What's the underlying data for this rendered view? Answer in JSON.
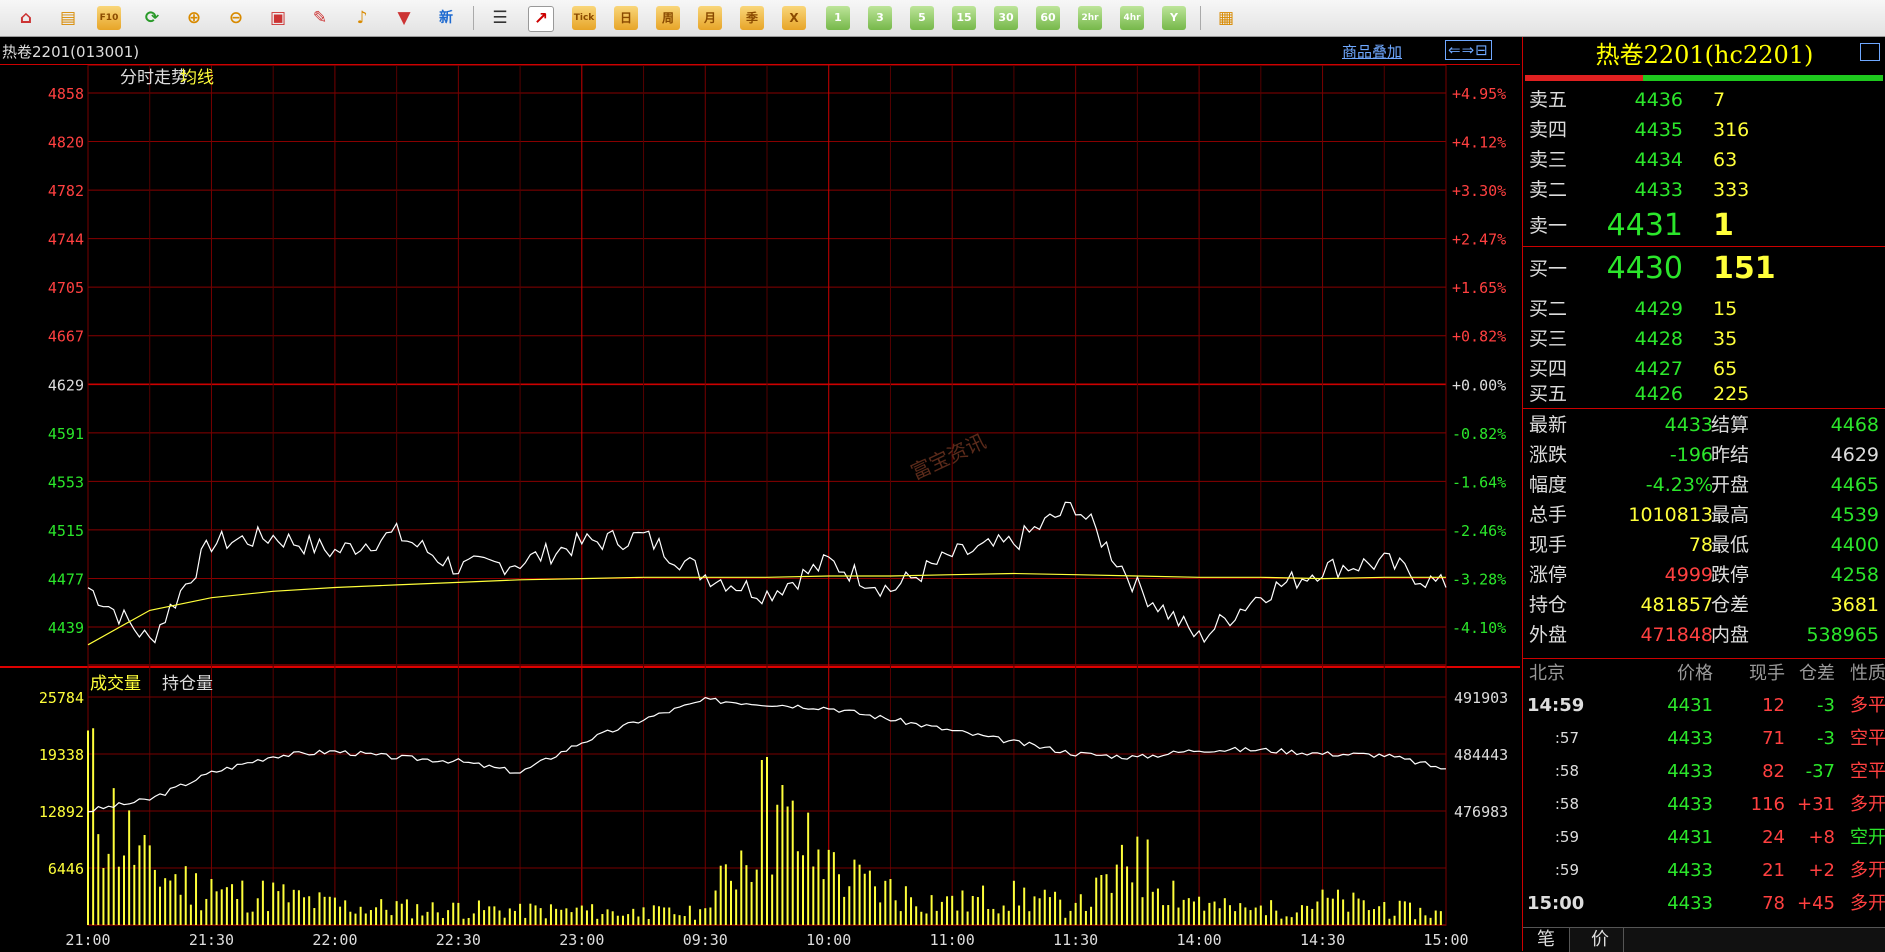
{
  "toolbar": {
    "items": [
      "home",
      "book",
      "f10",
      "refresh",
      "zoom-in",
      "zoom-out",
      "window",
      "pencil",
      "bell",
      "filter",
      "news"
    ],
    "news_label": "新",
    "f10_label": "F10",
    "tick_label": "Tick",
    "periods": [
      "日",
      "周",
      "月",
      "季",
      "X"
    ],
    "minutes": [
      "1",
      "3",
      "5",
      "15",
      "30",
      "60",
      "2hr",
      "4hr",
      "Y"
    ]
  },
  "header": {
    "symbol": "热卷2201(013001)",
    "overlay_link": "商品叠加"
  },
  "chart": {
    "price_title": "分时走势",
    "avg_title": "均线",
    "vol_title": "成交量",
    "oi_title": "持仓量",
    "price_ticks": [
      "4858",
      "4820",
      "4782",
      "4744",
      "4705",
      "4667",
      "4629",
      "4591",
      "4553",
      "4515",
      "4477",
      "4439"
    ],
    "pct_ticks": [
      "+4.95%",
      "+4.12%",
      "+3.30%",
      "+2.47%",
      "+1.65%",
      "+0.82%",
      "+0.00%",
      "-0.82%",
      "-1.64%",
      "-2.46%",
      "-3.28%",
      "-4.10%"
    ],
    "vol_ticks": [
      "25784",
      "19338",
      "12892",
      "6446"
    ],
    "oi_ticks": [
      "491903",
      "484443",
      "476983"
    ],
    "time_ticks": [
      "21:00",
      "21:30",
      "22:00",
      "22:30",
      "23:00",
      "09:30",
      "10:00",
      "11:00",
      "11:30",
      "14:00",
      "14:30",
      "15:00"
    ],
    "watermark": "富宝资讯"
  },
  "chart_data": {
    "type": "line",
    "price_range": [
      4439,
      4858
    ],
    "prev_settle": 4629,
    "avg_price": [
      4425,
      4452,
      4462,
      4467,
      4470,
      4472,
      4474,
      4476,
      4477,
      4478,
      4478,
      4478,
      4479,
      4479,
      4480,
      4481,
      4480,
      4479,
      4478,
      4478,
      4477,
      4478,
      4478
    ],
    "price": [
      4470,
      4428,
      4505,
      4510,
      4498,
      4512,
      4485,
      4490,
      4505,
      4510,
      4480,
      4465,
      4490,
      4468,
      4495,
      4505,
      4535,
      4470,
      4430,
      4465,
      4485,
      4490,
      4470
    ],
    "volume": [
      22000,
      9000,
      5200,
      4800,
      3100,
      2700,
      2500,
      2400,
      2200,
      2000,
      1900,
      19000,
      8500,
      5200,
      3300,
      5000,
      2500,
      10000,
      3200,
      2200,
      4000,
      2600,
      1800
    ],
    "open_interest": [
      477000,
      478500,
      482000,
      484200,
      484800,
      484000,
      483500,
      482000,
      486000,
      489000,
      491500,
      491000,
      490500,
      489000,
      487500,
      486000,
      484500,
      484000,
      485000,
      485000,
      484500,
      484300,
      482500
    ]
  },
  "panel": {
    "title": "热卷2201(hc2201)",
    "asks": [
      {
        "label": "卖五",
        "price": "4436",
        "vol": "7"
      },
      {
        "label": "卖四",
        "price": "4435",
        "vol": "316"
      },
      {
        "label": "卖三",
        "price": "4434",
        "vol": "63"
      },
      {
        "label": "卖二",
        "price": "4433",
        "vol": "333"
      },
      {
        "label": "卖一",
        "price": "4431",
        "vol": "1"
      }
    ],
    "bids": [
      {
        "label": "买一",
        "price": "4430",
        "vol": "151"
      },
      {
        "label": "买二",
        "price": "4429",
        "vol": "15"
      },
      {
        "label": "买三",
        "price": "4428",
        "vol": "35"
      },
      {
        "label": "买四",
        "price": "4427",
        "vol": "65"
      },
      {
        "label": "买五",
        "price": "4426",
        "vol": "225"
      }
    ],
    "stats": [
      {
        "k1": "最新",
        "v1": "4433",
        "c1": "g",
        "k2": "结算",
        "v2": "4468",
        "c2": "g"
      },
      {
        "k1": "涨跌",
        "v1": "-196",
        "c1": "g",
        "k2": "昨结",
        "v2": "4629",
        "c2": "w"
      },
      {
        "k1": "幅度",
        "v1": "-4.23%",
        "c1": "g",
        "k2": "开盘",
        "v2": "4465",
        "c2": "g"
      },
      {
        "k1": "总手",
        "v1": "1010813",
        "c1": "y",
        "k2": "最高",
        "v2": "4539",
        "c2": "g"
      },
      {
        "k1": "现手",
        "v1": "78",
        "c1": "y",
        "k2": "最低",
        "v2": "4400",
        "c2": "g"
      },
      {
        "k1": "涨停",
        "v1": "4999",
        "c1": "r",
        "k2": "跌停",
        "v2": "4258",
        "c2": "g"
      },
      {
        "k1": "持仓",
        "v1": "481857",
        "c1": "y",
        "k2": "仓差",
        "v2": "3681",
        "c2": "y"
      },
      {
        "k1": "外盘",
        "v1": "471848",
        "c1": "r",
        "k2": "内盘",
        "v2": "538965",
        "c2": "g"
      }
    ],
    "ticks_header": [
      "北京",
      "价格",
      "现手",
      "仓差",
      "性质"
    ],
    "ticks": [
      {
        "time": "14:59",
        "price": "4431",
        "qty": "12",
        "diff": "-3",
        "nature": "多平",
        "dc": "g",
        "nc": "r",
        "sm": false
      },
      {
        "time": ":57",
        "price": "4433",
        "qty": "71",
        "diff": "-3",
        "nature": "空平",
        "dc": "g",
        "nc": "r",
        "sm": true
      },
      {
        "time": ":58",
        "price": "4433",
        "qty": "82",
        "diff": "-37",
        "nature": "空平",
        "dc": "g",
        "nc": "r",
        "sm": true
      },
      {
        "time": ":58",
        "price": "4433",
        "qty": "116",
        "diff": "+31",
        "nature": "多开",
        "dc": "r",
        "nc": "r",
        "sm": true
      },
      {
        "time": ":59",
        "price": "4431",
        "qty": "24",
        "diff": "+8",
        "nature": "空开",
        "dc": "r",
        "nc": "g",
        "sm": true
      },
      {
        "time": ":59",
        "price": "4433",
        "qty": "21",
        "diff": "+2",
        "nature": "多开",
        "dc": "r",
        "nc": "r",
        "sm": true
      },
      {
        "time": "15:00",
        "price": "4433",
        "qty": "78",
        "diff": "+45",
        "nature": "多开",
        "dc": "r",
        "nc": "r",
        "sm": false
      }
    ],
    "tabs": [
      "笔",
      "价"
    ]
  }
}
